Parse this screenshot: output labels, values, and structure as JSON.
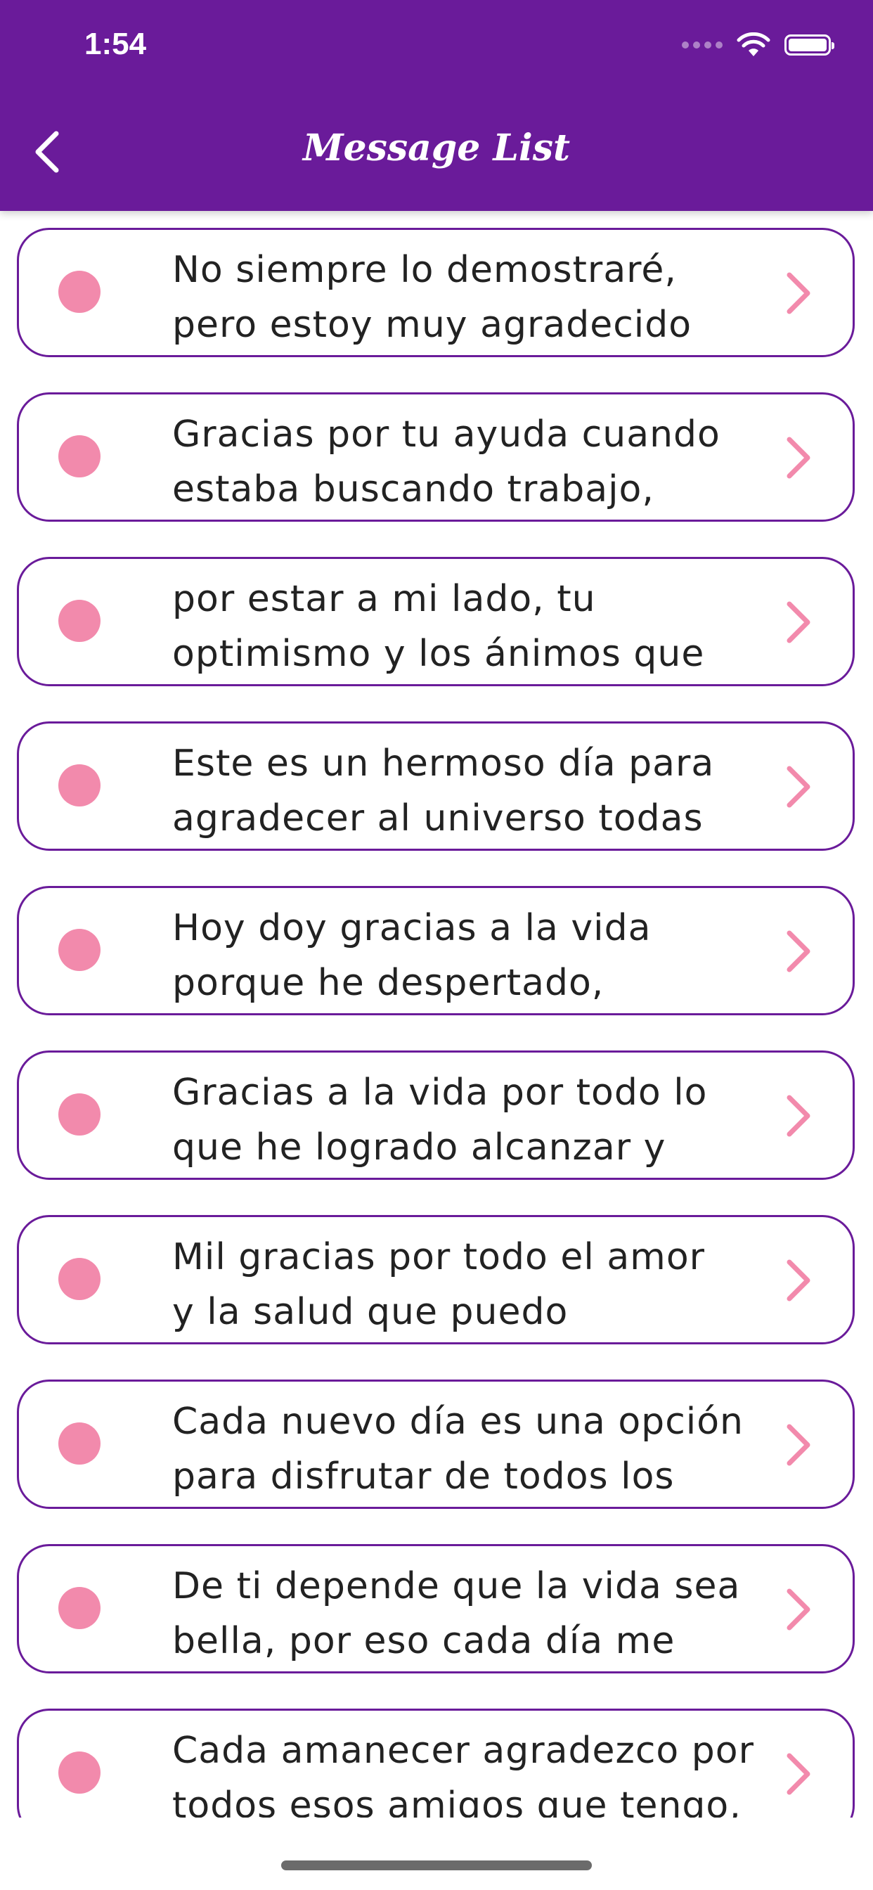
{
  "status_bar": {
    "time": "1:54"
  },
  "header": {
    "title": "Message List",
    "back_icon": "chevron-left-icon"
  },
  "colors": {
    "header_bg": "#6a1b9a",
    "card_border": "#6a1b9a",
    "bullet": "#f28aac",
    "chevron": "#f28aac"
  },
  "messages": [
    {
      "text": "No siempre lo demostraré,\npero estoy muy agradecido"
    },
    {
      "text": "Gracias por tu ayuda cuando\nestaba buscando trabajo,"
    },
    {
      "text": "por estar a mi lado, tu\noptimismo y los ánimos que"
    },
    {
      "text": "Este es un hermoso día para\nagradecer al universo todas"
    },
    {
      "text": "Hoy doy gracias a la vida\nporque he despertado,"
    },
    {
      "text": "Gracias a la vida por todo lo\nque he logrado alcanzar y"
    },
    {
      "text": "Mil gracias por todo el amor\ny la salud que puedo"
    },
    {
      "text": "Cada nuevo día es una opción\npara disfrutar de todos los"
    },
    {
      "text": "De ti depende que la vida sea\nbella, por eso cada día me"
    },
    {
      "text": "Cada amanecer agradezco por\ntodos esos amigos que tengo,"
    }
  ]
}
